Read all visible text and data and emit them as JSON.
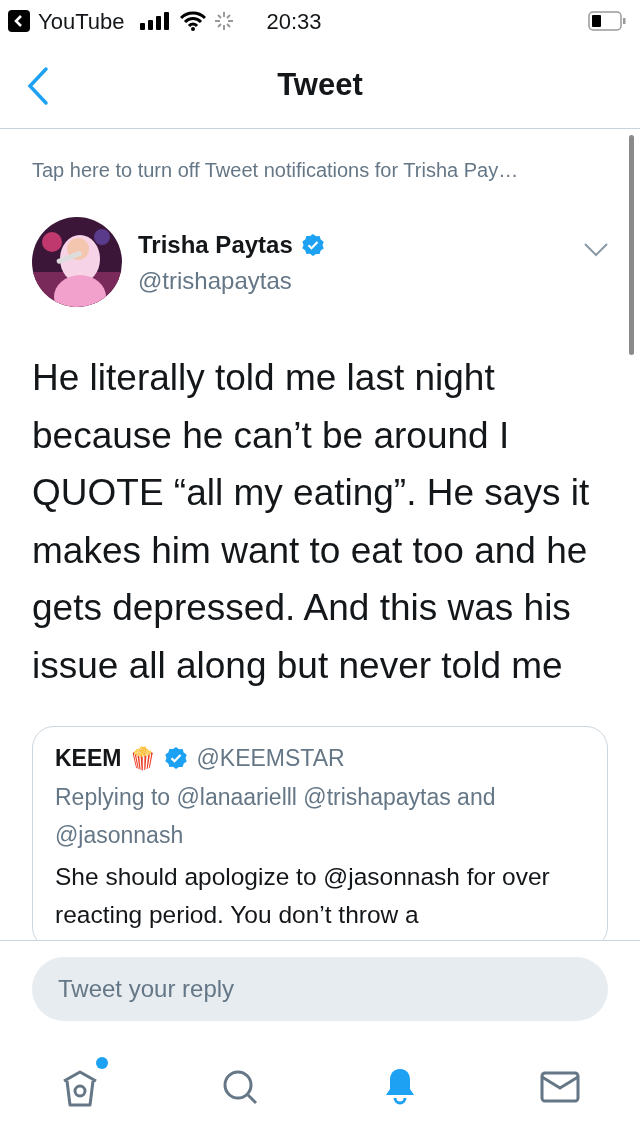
{
  "status_bar": {
    "back_app": "YouTube",
    "time": "20:33"
  },
  "nav": {
    "title": "Tweet"
  },
  "notice": "Tap here to turn off Tweet notifications for Trisha Pay…",
  "tweet": {
    "name": "Trisha Paytas",
    "verified": true,
    "handle": "@trishapaytas",
    "text": "He literally told me last night because he can’t be around I QUOTE “all my eating”. He says it makes him want to eat too and he gets depressed. And this was his issue all along but never told me"
  },
  "quoted": {
    "name": "KEEM",
    "emoji": "🍿",
    "verified": true,
    "handle": "@KEEMSTAR",
    "replying": "Replying to @lanaarielll @trishapaytas and @jasonnash",
    "text": "She should apologize to @jasonnash for over reacting period. You don’t throw a"
  },
  "reply": {
    "placeholder": "Tweet your reply"
  },
  "tabs": [
    {
      "kind": "home",
      "selected": false,
      "dot": true
    },
    {
      "kind": "search",
      "selected": false,
      "dot": false
    },
    {
      "kind": "notifications",
      "selected": true,
      "dot": false
    },
    {
      "kind": "messages",
      "selected": false,
      "dot": false
    }
  ]
}
